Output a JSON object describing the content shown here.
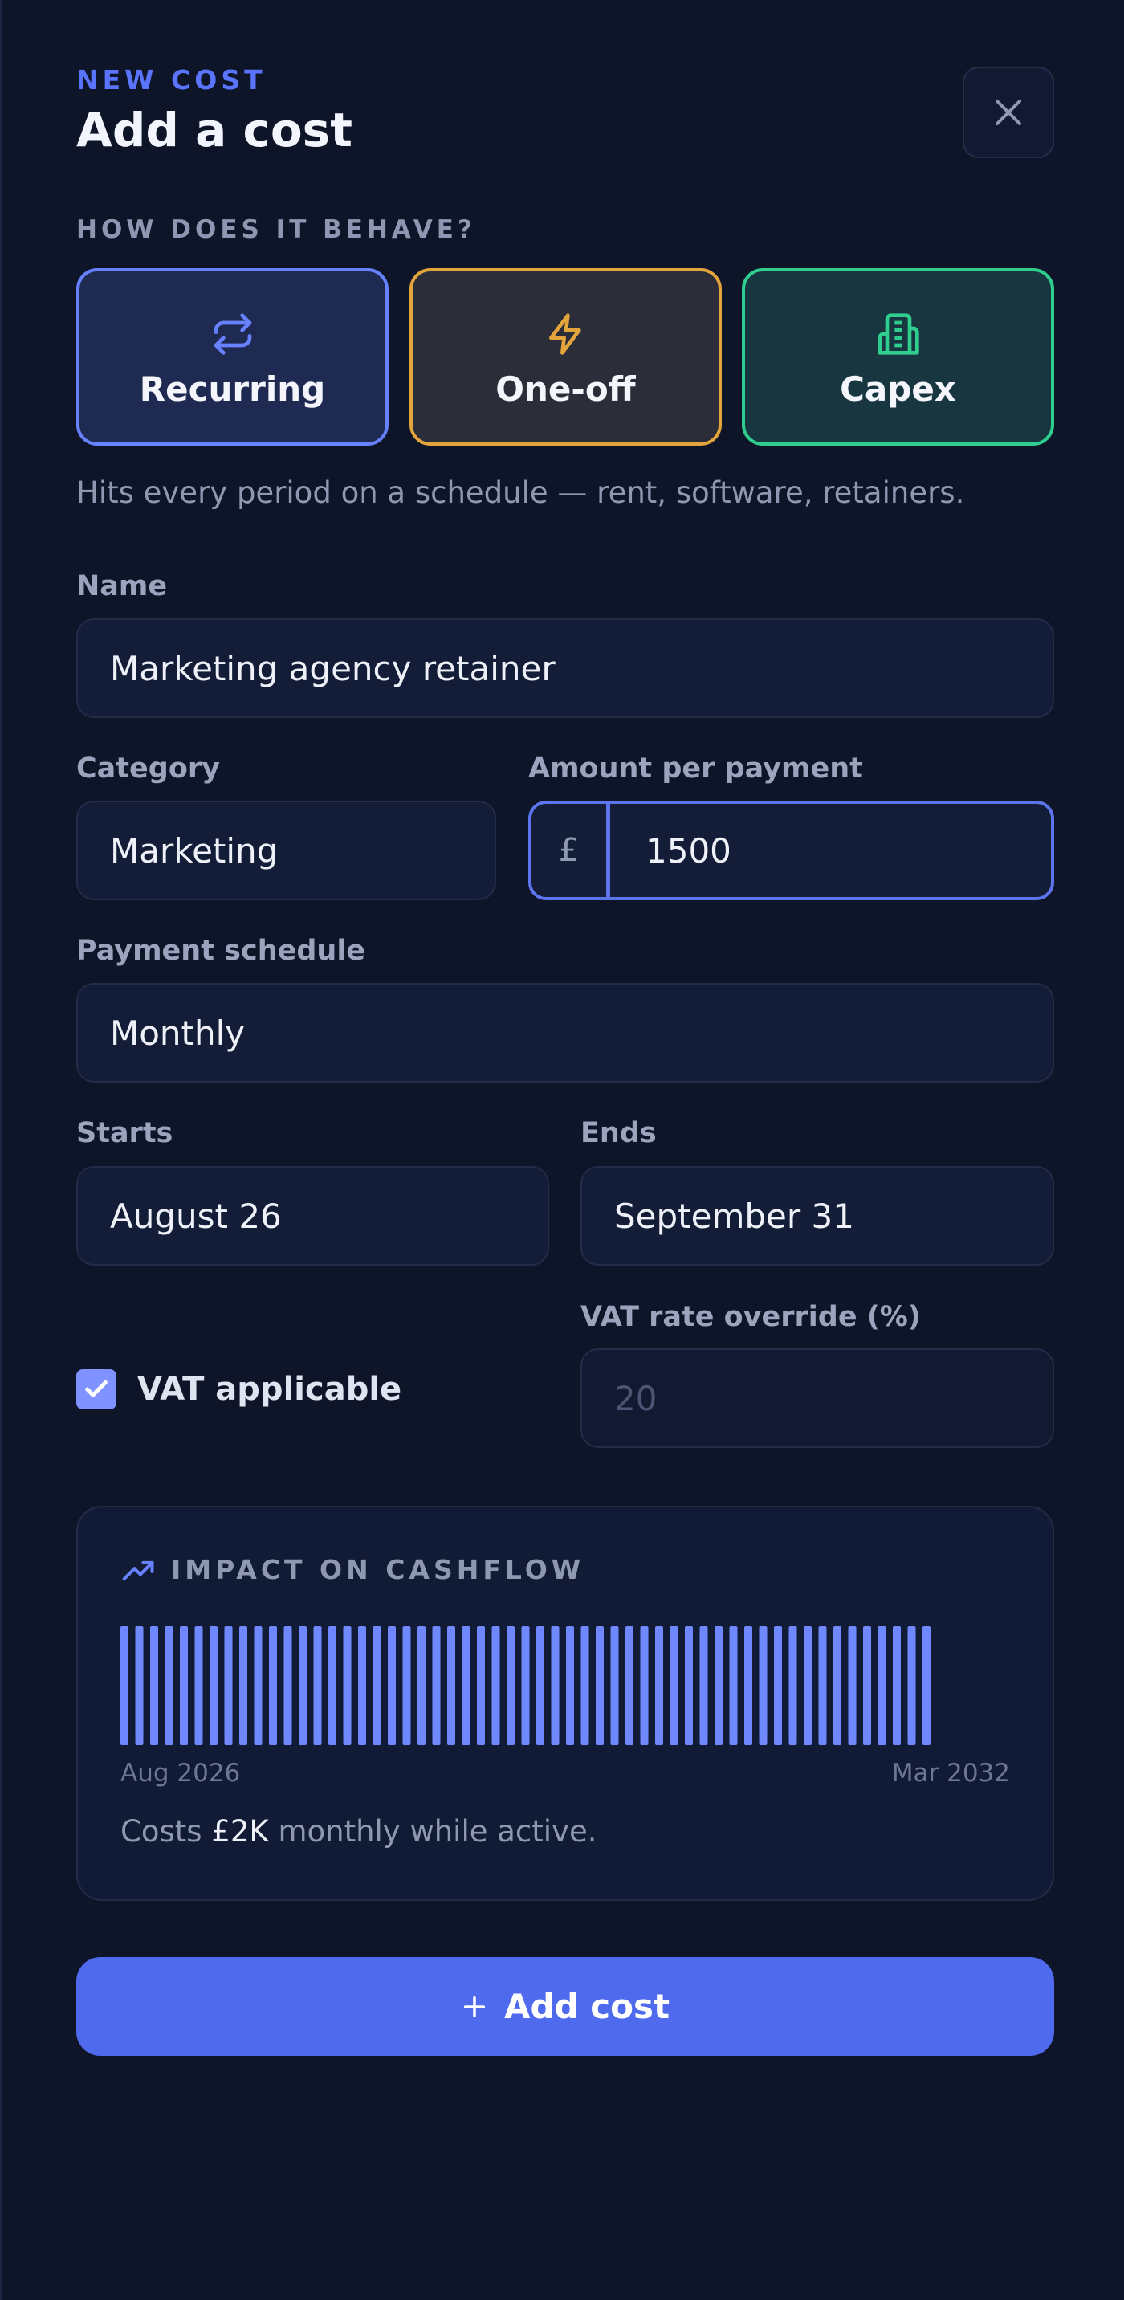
{
  "header": {
    "eyebrow": "NEW COST",
    "title": "Add a cost"
  },
  "behaviour": {
    "label": "HOW DOES IT BEHAVE?",
    "options": [
      {
        "label": "Recurring",
        "icon": "repeat-icon",
        "color": "#6781ff",
        "selected": true
      },
      {
        "label": "One-off",
        "icon": "lightning-icon",
        "color": "#e3a43c",
        "selected": false
      },
      {
        "label": "Capex",
        "icon": "building-icon",
        "color": "#2fce8e",
        "selected": false
      }
    ],
    "helper": "Hits every period on a schedule — rent, software, retainers."
  },
  "form": {
    "name": {
      "label": "Name",
      "value": "Marketing agency retainer"
    },
    "category": {
      "label": "Category",
      "value": "Marketing"
    },
    "amount": {
      "label": "Amount per payment",
      "currency": "£",
      "value": "1500"
    },
    "schedule": {
      "label": "Payment schedule",
      "value": "Monthly"
    },
    "starts": {
      "label": "Starts",
      "value": "August 26"
    },
    "ends": {
      "label": "Ends",
      "value": "September 31"
    },
    "vat": {
      "label": "VAT applicable",
      "checked": true
    },
    "vat_rate": {
      "label": "VAT rate override (%)",
      "placeholder": "20"
    }
  },
  "impact": {
    "title": "IMPACT ON CASHFLOW",
    "start_label": "Aug 2026",
    "end_label": "Mar 2032",
    "bar_count": 55,
    "summary_prefix": "Costs",
    "summary_amount": "£2K",
    "summary_suffix": "monthly while active.",
    "bar_color": "#7088ff"
  },
  "actions": {
    "add_label": "Add cost",
    "accent": "#4f6aec"
  }
}
